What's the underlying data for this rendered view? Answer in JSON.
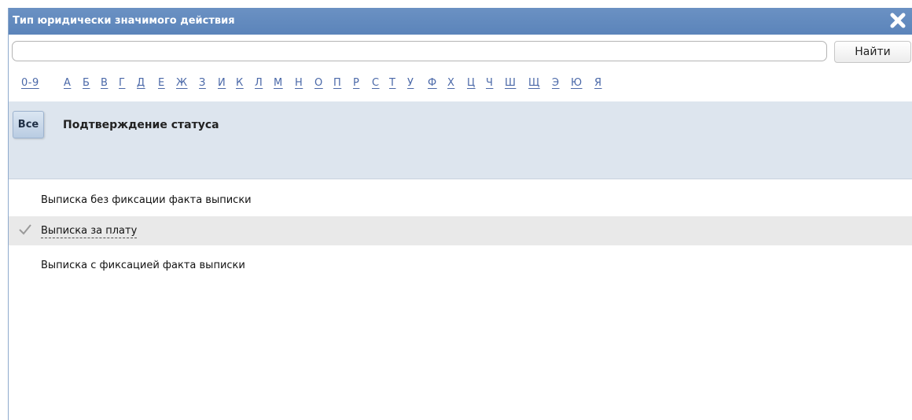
{
  "dialog": {
    "title": "Тип юридически значимого действия",
    "close_icon": "close-icon"
  },
  "search": {
    "value": "",
    "placeholder": "",
    "button_label": "Найти"
  },
  "alphabet": [
    "0-9",
    "А",
    "Б",
    "В",
    "Г",
    "Д",
    "Е",
    "Ж",
    "З",
    "И",
    "К",
    "Л",
    "М",
    "Н",
    "О",
    "П",
    "Р",
    "С",
    "Т",
    "У",
    "Ф",
    "Х",
    "Ц",
    "Ч",
    "Ш",
    "Щ",
    "Э",
    "Ю",
    "Я"
  ],
  "categories": {
    "all_label": "Все",
    "selected_label": "Подтверждение статуса"
  },
  "items": [
    {
      "label": "Выписка без фиксации факта выписки",
      "selected": false
    },
    {
      "label": "Выписка за плату",
      "selected": true
    },
    {
      "label": "Выписка с фиксацией факта выписки",
      "selected": false
    }
  ],
  "colors": {
    "titlebar": "#5b84ba",
    "letter_link": "#4a68a8",
    "category_panel": "#dde5ee",
    "selected_row": "#e9e9e9"
  }
}
